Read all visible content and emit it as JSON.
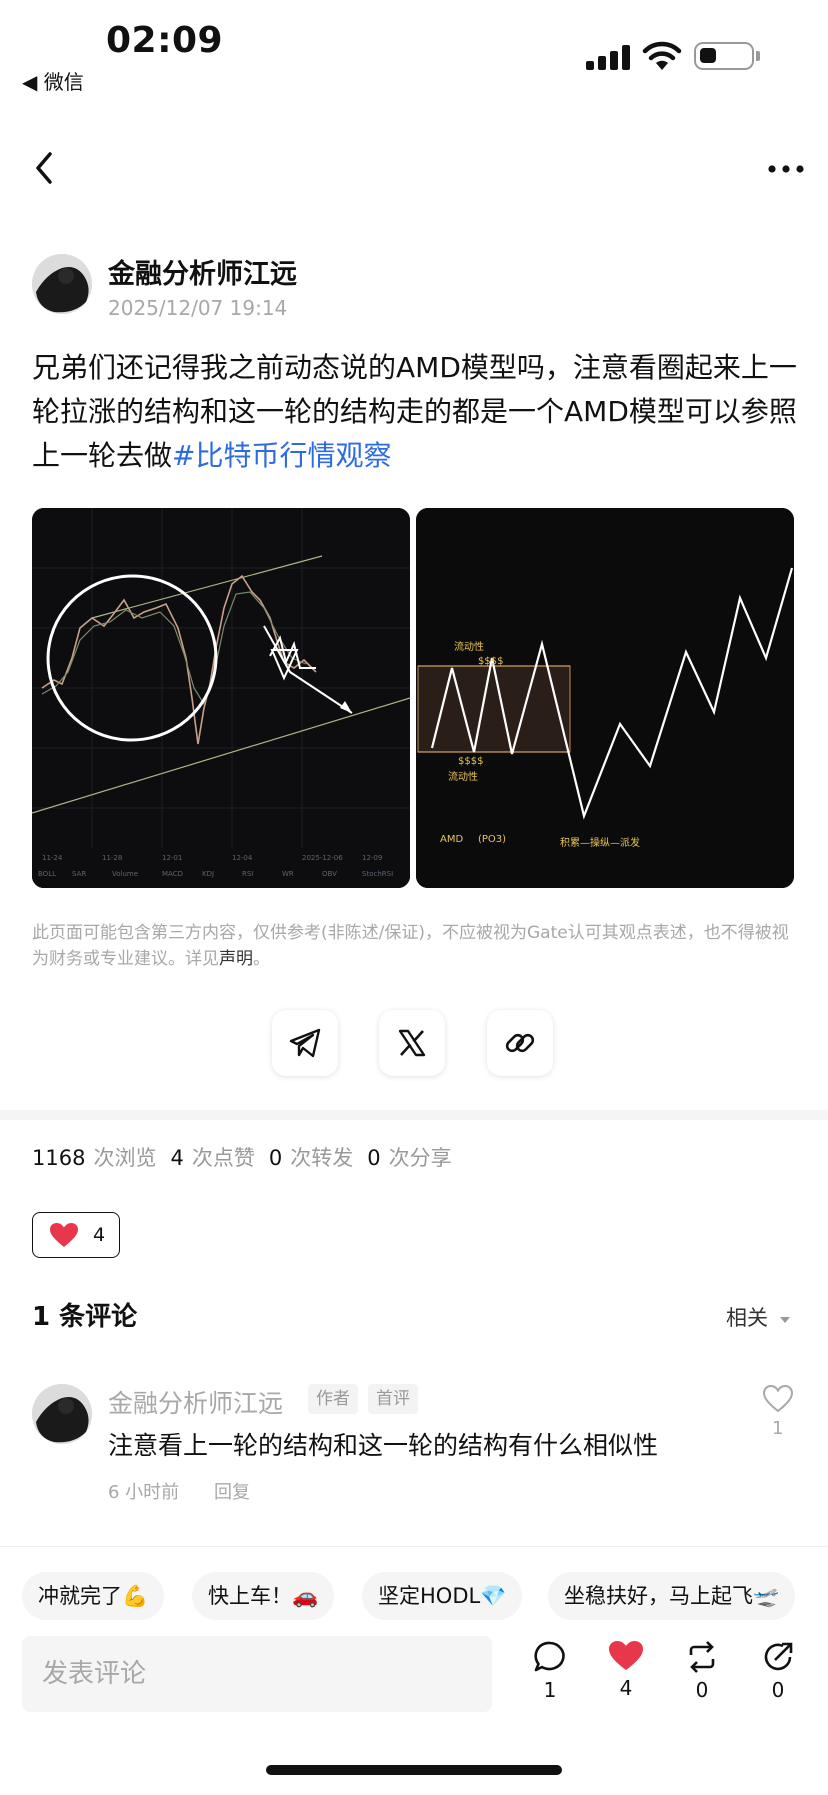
{
  "status_bar": {
    "time": "02:09",
    "back_app": "◀ 微信"
  },
  "post": {
    "author": "金融分析师江远",
    "time": "2025/12/07 19:14",
    "text": "兄弟们还记得我之前动态说的AMD模型吗，注意看圈起来上一轮拉涨的结构和这一轮的结构走的都是一个AMD模型可以参照上一轮去做",
    "hashtag": "#比特币行情观察",
    "image2_labels": {
      "liq_top": "流动性",
      "dollar_top": "$$$$",
      "dollar_bottom": "$$$$",
      "liq_bottom": "流动性",
      "amd": "AMD",
      "po3": "(PO3)",
      "phases": "积累—操纵—派发"
    }
  },
  "disclaimer": {
    "text": "此页面可能包含第三方内容，仅供参考(非陈述/保证)，不应被视为Gate认可其观点表述，也不得被视为财务或专业建议。详见",
    "link": "声明",
    "end": "。"
  },
  "stats": {
    "views": "1168",
    "views_label": "次浏览",
    "likes": "4",
    "likes_label": "次点赞",
    "reposts": "0",
    "reposts_label": "次转发",
    "shares": "0",
    "shares_label": "次分享"
  },
  "reaction": {
    "count": "4"
  },
  "comments": {
    "title": "1 条评论",
    "sort": "相关",
    "items": [
      {
        "name": "金融分析师江远",
        "tag_author": "作者",
        "tag_first": "首评",
        "text": "注意看上一轮的结构和这一轮的结构有什么相似性",
        "time": "6 小时前",
        "reply": "回复",
        "likes": "1"
      }
    ]
  },
  "quick_replies": [
    "冲就完了💪",
    "快上车！🚗",
    "坚定HODL💎",
    "坐稳扶好，马上起飞🛫"
  ],
  "bottom_bar": {
    "input_placeholder": "发表评论",
    "comment_count": "1",
    "like_count": "4",
    "repost_count": "0",
    "share_count": "0"
  },
  "colors": {
    "hashtag": "#2d6be4",
    "heart": "#e8374a"
  }
}
